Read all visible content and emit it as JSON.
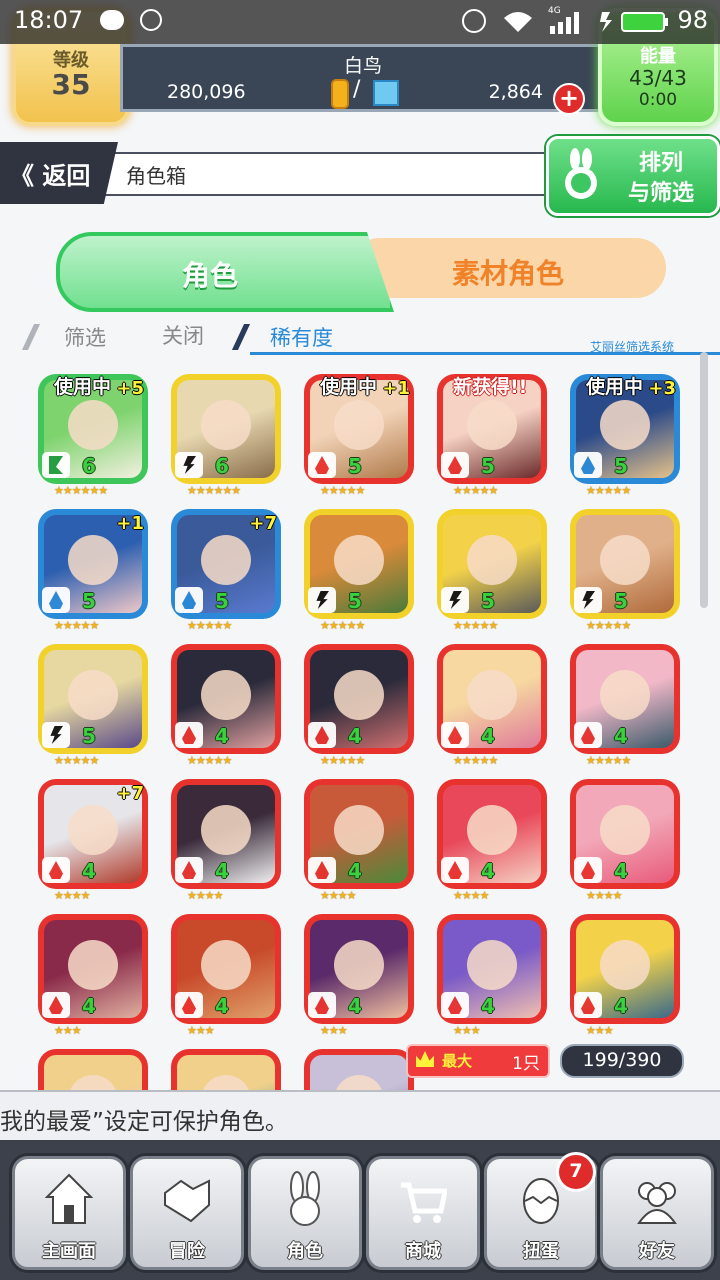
{
  "status_bar": {
    "time": "18:07",
    "network": "4G",
    "battery": "98"
  },
  "player": {
    "level_label": "等级",
    "level": "35",
    "name": "白鸟",
    "coins": "280,096",
    "gems": "2,864",
    "energy_label": "能量",
    "energy": "43/43",
    "energy_timer": "0:00"
  },
  "breadcrumb": {
    "back_label": "返回",
    "title": "角色箱"
  },
  "sort_button": {
    "line1": "排列",
    "line2": "与筛选"
  },
  "tabs": [
    {
      "label": "角色",
      "active": true
    },
    {
      "label": "素材角色",
      "active": false
    }
  ],
  "filter": {
    "filter_label": "筛选",
    "state": "关闭",
    "sort_key": "稀有度",
    "system_label": "艾丽丝筛选系统"
  },
  "grid": {
    "cards": [
      {
        "element": "wood",
        "frame": "#3fc65a",
        "art": [
          "#7ed36e",
          "#f3f0e0"
        ],
        "level": "6",
        "plus": "+5",
        "flag": "使用中",
        "stars": 6
      },
      {
        "element": "thunder",
        "frame": "#f2d12a",
        "art": [
          "#e7d8b0",
          "#8a6d4a"
        ],
        "level": "6",
        "plus": "",
        "flag": "",
        "stars": 6
      },
      {
        "element": "fire",
        "frame": "#e8322e",
        "art": [
          "#f2d3b8",
          "#b07a4a"
        ],
        "level": "5",
        "plus": "+1",
        "flag": "使用中",
        "stars": 5
      },
      {
        "element": "fire",
        "frame": "#e8322e",
        "art": [
          "#f6d2c4",
          "#6b2a2a"
        ],
        "level": "5",
        "plus": "",
        "flag": "新获得!!",
        "stars": 5
      },
      {
        "element": "water",
        "frame": "#2a8ad8",
        "art": [
          "#2b4a8a",
          "#e6c28a"
        ],
        "level": "5",
        "plus": "+3",
        "flag": "使用中",
        "stars": 5
      },
      {
        "element": "water",
        "frame": "#2a8ad8",
        "art": [
          "#2d5fb0",
          "#f0c8c8"
        ],
        "level": "5",
        "plus": "+1",
        "flag": "",
        "stars": 5
      },
      {
        "element": "water",
        "frame": "#2a8ad8",
        "art": [
          "#3a5a9a",
          "#5a7ad0"
        ],
        "level": "5",
        "plus": "+7",
        "flag": "",
        "stars": 5
      },
      {
        "element": "thunder",
        "frame": "#f2d12a",
        "art": [
          "#d98a3a",
          "#4a7a3a"
        ],
        "level": "5",
        "plus": "",
        "flag": "",
        "stars": 5
      },
      {
        "element": "thunder",
        "frame": "#f2d12a",
        "art": [
          "#f3d24a",
          "#5a5a5a"
        ],
        "level": "5",
        "plus": "",
        "flag": "",
        "stars": 5
      },
      {
        "element": "thunder",
        "frame": "#f2d12a",
        "art": [
          "#e0b08a",
          "#b06a3a"
        ],
        "level": "5",
        "plus": "",
        "flag": "",
        "stars": 5
      },
      {
        "element": "thunder",
        "frame": "#f2d12a",
        "art": [
          "#e6d8a0",
          "#5a4a8a"
        ],
        "level": "5",
        "plus": "",
        "flag": "",
        "stars": 5
      },
      {
        "element": "fire",
        "frame": "#e8322e",
        "art": [
          "#2a2a3a",
          "#e0a0a0"
        ],
        "level": "4",
        "plus": "",
        "flag": "",
        "stars": 5
      },
      {
        "element": "fire",
        "frame": "#e8322e",
        "art": [
          "#2a2a3a",
          "#d07070"
        ],
        "level": "4",
        "plus": "",
        "flag": "",
        "stars": 5
      },
      {
        "element": "fire",
        "frame": "#e8322e",
        "art": [
          "#f6d8a0",
          "#e07a9a"
        ],
        "level": "4",
        "plus": "",
        "flag": "",
        "stars": 5
      },
      {
        "element": "fire",
        "frame": "#e8322e",
        "art": [
          "#f2b8c8",
          "#3a5a6a"
        ],
        "level": "4",
        "plus": "",
        "flag": "",
        "stars": 5
      },
      {
        "element": "fire",
        "frame": "#e8322e",
        "art": [
          "#e6e6ea",
          "#b03a2a"
        ],
        "level": "4",
        "plus": "+7",
        "flag": "",
        "stars": 4
      },
      {
        "element": "fire",
        "frame": "#e8322e",
        "art": [
          "#3a2a3a",
          "#f0f0f0"
        ],
        "level": "4",
        "plus": "",
        "flag": "",
        "stars": 4
      },
      {
        "element": "fire",
        "frame": "#e8322e",
        "art": [
          "#c85a3a",
          "#4a8a3a"
        ],
        "level": "4",
        "plus": "",
        "flag": "",
        "stars": 4
      },
      {
        "element": "fire",
        "frame": "#e8322e",
        "art": [
          "#e8485a",
          "#f6d2c4"
        ],
        "level": "4",
        "plus": "",
        "flag": "",
        "stars": 4
      },
      {
        "element": "fire",
        "frame": "#e8322e",
        "art": [
          "#f2a8b8",
          "#e85a7a"
        ],
        "level": "4",
        "plus": "",
        "flag": "",
        "stars": 4
      },
      {
        "element": "fire",
        "frame": "#e8322e",
        "art": [
          "#8a2a4a",
          "#e0b0a0"
        ],
        "level": "4",
        "plus": "",
        "flag": "",
        "stars": 3
      },
      {
        "element": "fire",
        "frame": "#e8322e",
        "art": [
          "#c84a2a",
          "#e0a06a"
        ],
        "level": "4",
        "plus": "",
        "flag": "",
        "stars": 3
      },
      {
        "element": "fire",
        "frame": "#e8322e",
        "art": [
          "#5a2a6a",
          "#f0c0a0"
        ],
        "level": "4",
        "plus": "",
        "flag": "",
        "stars": 3
      },
      {
        "element": "fire",
        "frame": "#e8322e",
        "art": [
          "#7a5ac8",
          "#f0c0b0"
        ],
        "level": "4",
        "plus": "",
        "flag": "",
        "stars": 3
      },
      {
        "element": "fire",
        "frame": "#e8322e",
        "art": [
          "#f3d24a",
          "#3a6a8a"
        ],
        "level": "4",
        "plus": "",
        "flag": "",
        "stars": 3
      },
      {
        "element": "fire",
        "frame": "#e8322e",
        "art": [
          "#f0d08a",
          "#f2b8c8"
        ],
        "level": "",
        "plus": "",
        "flag": "",
        "stars": 0
      },
      {
        "element": "fire",
        "frame": "#e8322e",
        "art": [
          "#f0d08a",
          "#3a8a8a"
        ],
        "level": "",
        "plus": "",
        "flag": "",
        "stars": 0
      },
      {
        "element": "fire",
        "frame": "#e8322e",
        "art": [
          "#c8c0d8",
          "#6a5aa0"
        ],
        "level": "",
        "plus": "",
        "flag": "",
        "stars": 0
      }
    ]
  },
  "max_tag": {
    "label": "最大",
    "value": "1只"
  },
  "box_count": "199/390",
  "hint": "我的最爱”设定可保护角色。",
  "nav": {
    "items": [
      {
        "label": "主画面",
        "icon": "home-icon"
      },
      {
        "label": "冒险",
        "icon": "handshake-icon"
      },
      {
        "label": "角色",
        "icon": "rabbit-icon"
      },
      {
        "label": "商城",
        "icon": "cart-icon"
      },
      {
        "label": "扭蛋",
        "icon": "egg-icon"
      },
      {
        "label": "好友",
        "icon": "friends-icon"
      }
    ],
    "gacha_badge": "7"
  },
  "colors": {
    "accent_green": "#34c95e",
    "accent_orange": "#f0822a",
    "fire": "#e8322e",
    "water": "#2a8ad8",
    "thunder": "#f2d12a",
    "wood": "#3fc65a"
  }
}
